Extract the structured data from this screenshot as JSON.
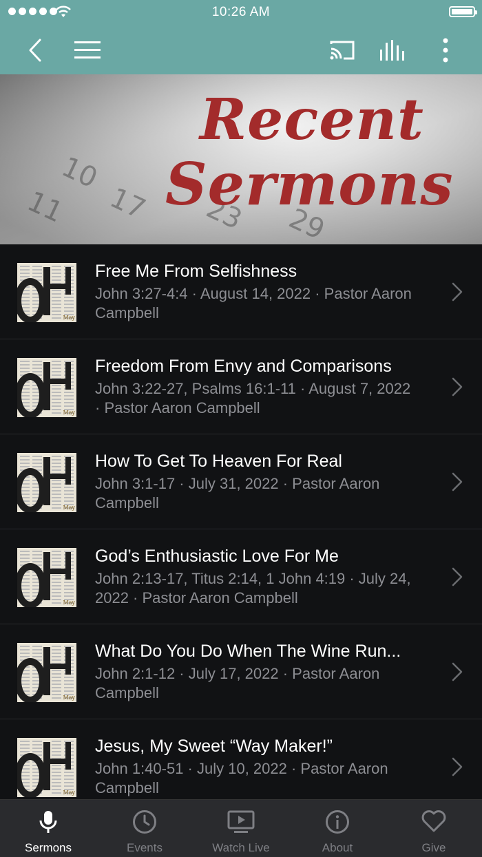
{
  "status_bar": {
    "time": "10:26 AM"
  },
  "nav": {
    "back_icon": "chevron-left-icon",
    "menu_icon": "hamburger-menu-icon",
    "cast_icon": "cast-icon",
    "equalizer_icon": "equalizer-icon",
    "more_icon": "more-vertical-icon"
  },
  "hero": {
    "line1": "Recent",
    "line2": "Sermons"
  },
  "sermons": [
    {
      "title": "Free Me From Selfishness",
      "subtitle": "John 3:27-4:4 · August 14, 2022 · Pastor Aaron Campbell"
    },
    {
      "title": "Freedom From Envy and Comparisons",
      "subtitle": "John 3:22-27, Psalms 16:1-11 · August 7, 2022 · Pastor Aaron Campbell"
    },
    {
      "title": "How To Get To Heaven For Real",
      "subtitle": "John 3:1-17 · July 31, 2022 · Pastor Aaron Campbell"
    },
    {
      "title": "God’s Enthusiastic Love For Me",
      "subtitle": "John 2:13-17, Titus 2:14, 1 John 4:19 · July 24, 2022 · Pastor Aaron Campbell"
    },
    {
      "title": "What Do You Do When The Wine Run...",
      "subtitle": "John 2:1-12 · July 17, 2022 · Pastor Aaron Campbell"
    },
    {
      "title": "Jesus, My Sweet “Way Maker!”",
      "subtitle": "John 1:40-51 · July 10, 2022 · Pastor Aaron Campbell"
    }
  ],
  "tabs": [
    {
      "label": "Sermons",
      "icon": "microphone-icon",
      "active": true
    },
    {
      "label": "Events",
      "icon": "clock-icon",
      "active": false
    },
    {
      "label": "Watch Live",
      "icon": "tv-play-icon",
      "active": false
    },
    {
      "label": "About",
      "icon": "info-icon",
      "active": false
    },
    {
      "label": "Give",
      "icon": "heart-icon",
      "active": false
    }
  ],
  "colors": {
    "header": "#6aa8a4",
    "background": "#111214",
    "tab_bar": "#2a2b2e",
    "title_red": "#a32b2b"
  }
}
